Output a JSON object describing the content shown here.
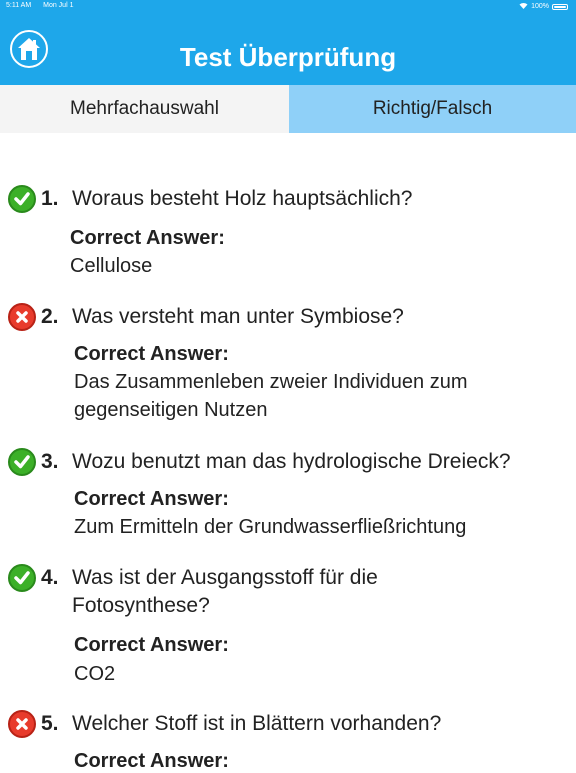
{
  "status_bar": {
    "time": "5:11 AM",
    "date": "Mon Jul 1",
    "wifi_icon": "wifi-icon",
    "battery": "100%"
  },
  "header": {
    "home_icon": "home-icon",
    "title": "Test Überprüfung"
  },
  "tabs": [
    {
      "label": "Mehrfachauswahl"
    },
    {
      "label": "Richtig/Falsch"
    }
  ],
  "colors": {
    "accent": "#1ea7ea",
    "tab_active_bg": "#8fd0f8",
    "correct": "#3cb028",
    "wrong": "#e83b2c"
  },
  "questions": [
    {
      "number": "1.",
      "text": "Woraus besteht Holz hauptsächlich?",
      "status": "correct",
      "answer_label": "Correct Answer:",
      "answer": "Cellulose"
    },
    {
      "number": "2.",
      "text": "Was versteht man unter Symbiose?",
      "status": "wrong",
      "answer_label": "Correct Answer:",
      "answer": "Das Zusammenleben zweier Individuen zum gegenseitigen Nutzen"
    },
    {
      "number": "3.",
      "text": "Wozu benutzt man das hydrologische Dreieck?",
      "status": "correct",
      "answer_label": "Correct Answer:",
      "answer": "Zum Ermitteln der Grundwasserfließrichtung"
    },
    {
      "number": "4.",
      "text": "Was ist der Ausgangsstoff für die Fotosynthese?",
      "status": "correct",
      "answer_label": "Correct Answer:",
      "answer": "CO2"
    },
    {
      "number": "5.",
      "text": "Welcher Stoff ist in Blättern vorhanden?",
      "status": "wrong",
      "answer_label": "Correct Answer:",
      "answer": ""
    }
  ]
}
